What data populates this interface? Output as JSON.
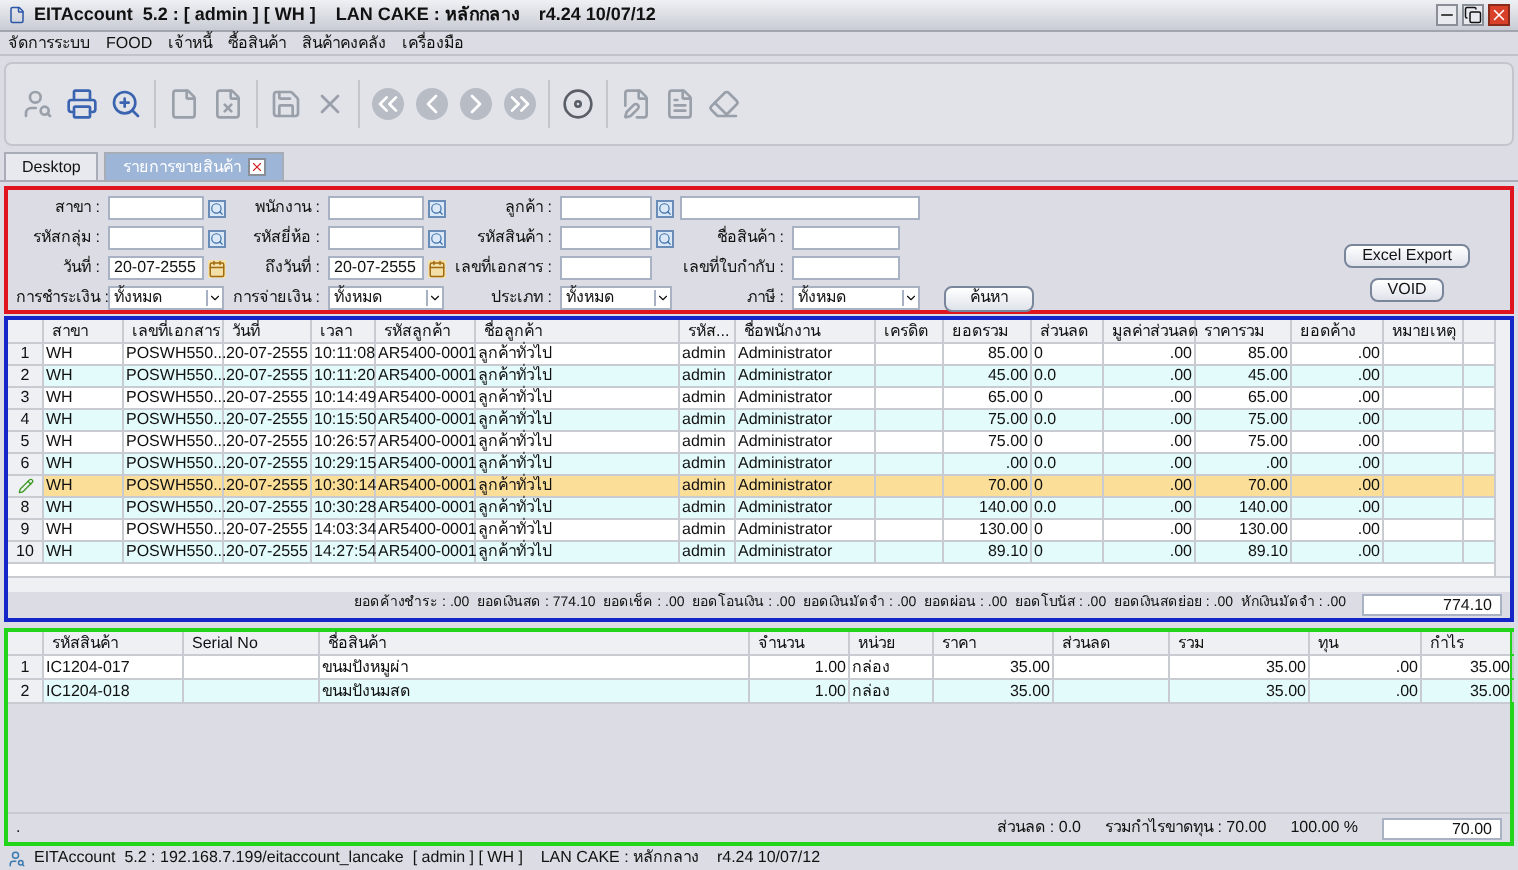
{
  "window": {
    "title": "EITAccount  5.2 : [ admin ] [ WH ]    LAN CAKE : หลักกลาง    r4.24 10/07/12"
  },
  "menu": [
    "จัดการระบบ",
    "FOOD",
    "เจ้าหนี้",
    "ซื้อสินค้า",
    "สินค้าคงคลัง",
    "เครื่องมือ"
  ],
  "tabs": [
    {
      "label": "Desktop",
      "selected": false,
      "closable": false
    },
    {
      "label": "รายการขายสินค้า",
      "selected": true,
      "closable": true
    }
  ],
  "filters": [
    [
      {
        "kind": "lookup",
        "label": "สาขา :"
      },
      {
        "kind": "lookup",
        "label": "พนักงาน :"
      },
      {
        "kind": "lookup",
        "label": "ลูกค้า :"
      },
      {
        "kind": "text"
      }
    ],
    [
      {
        "kind": "lookup",
        "label": "รหัสกลุ่ม :"
      },
      {
        "kind": "lookup",
        "label": "รหัสยี่ห้อ :"
      },
      {
        "kind": "lookup",
        "label": "รหัสสินค้า :"
      },
      {
        "kind": "text",
        "label": "ชื่อสินค้า :"
      }
    ],
    [
      {
        "kind": "date",
        "label": "วันที่ :",
        "value": "20-07-2555"
      },
      {
        "kind": "date",
        "label": "ถึงวันที่ :",
        "value": "20-07-2555"
      },
      {
        "kind": "text",
        "label": "เลขที่เอกสาร :"
      },
      {
        "kind": "text",
        "label": "เลขที่ใบกำกับ :"
      }
    ],
    [
      {
        "kind": "select",
        "label": "การชำระเงิน :",
        "value": "ทั้งหมด"
      },
      {
        "kind": "select",
        "label": "การจ่ายเงิน :",
        "value": "ทั้งหมด"
      },
      {
        "kind": "select",
        "label": "ประเภท :",
        "value": "ทั้งหมด"
      },
      {
        "kind": "select",
        "label": "ภาษี :",
        "value": "ทั้งหมด"
      },
      {
        "kind": "button",
        "label": "ค้นหา"
      }
    ]
  ],
  "actions": [
    "Excel Export",
    "VOID"
  ],
  "sales": {
    "columns": [
      "สาขา",
      "เลขที่เอกสาร",
      "วันที่",
      "เวลา",
      "รหัสลูกค้า",
      "ชื่อลูกค้า",
      "รหัส...",
      "ชื่อพนักงาน",
      "เครดิต",
      "ยอดรวม",
      "ส่วนลด",
      "มูลค่าส่วนลด",
      "ราคารวม",
      "ยอดค้าง",
      "หมายเหตุ"
    ],
    "rows": [
      {
        "number": "1",
        "selected": false,
        "cells": [
          "WH",
          "POSWH550...",
          "20-07-2555",
          "10:11:08",
          "AR5400-0001",
          "ลูกค้าทั่วไป",
          "admin",
          "Administrator",
          "",
          "85.00",
          "0",
          ".00",
          "85.00",
          ".00",
          ""
        ]
      },
      {
        "number": "2",
        "selected": false,
        "cells": [
          "WH",
          "POSWH550...",
          "20-07-2555",
          "10:11:20",
          "AR5400-0001",
          "ลูกค้าทั่วไป",
          "admin",
          "Administrator",
          "",
          "45.00",
          "0.0",
          ".00",
          "45.00",
          ".00",
          ""
        ]
      },
      {
        "number": "3",
        "selected": false,
        "cells": [
          "WH",
          "POSWH550...",
          "20-07-2555",
          "10:14:49",
          "AR5400-0001",
          "ลูกค้าทั่วไป",
          "admin",
          "Administrator",
          "",
          "65.00",
          "0",
          ".00",
          "65.00",
          ".00",
          ""
        ]
      },
      {
        "number": "4",
        "selected": false,
        "cells": [
          "WH",
          "POSWH550...",
          "20-07-2555",
          "10:15:50",
          "AR5400-0001",
          "ลูกค้าทั่วไป",
          "admin",
          "Administrator",
          "",
          "75.00",
          "0.0",
          ".00",
          "75.00",
          ".00",
          ""
        ]
      },
      {
        "number": "5",
        "selected": false,
        "cells": [
          "WH",
          "POSWH550...",
          "20-07-2555",
          "10:26:57",
          "AR5400-0001",
          "ลูกค้าทั่วไป",
          "admin",
          "Administrator",
          "",
          "75.00",
          "0",
          ".00",
          "75.00",
          ".00",
          ""
        ]
      },
      {
        "number": "6",
        "selected": false,
        "cells": [
          "WH",
          "POSWH550...",
          "20-07-2555",
          "10:29:15",
          "AR5400-0001",
          "ลูกค้าทั่วไป",
          "admin",
          "Administrator",
          "",
          ".00",
          "0.0",
          ".00",
          ".00",
          ".00",
          ""
        ]
      },
      {
        "selected": true,
        "cells": [
          "WH",
          "POSWH550...",
          "20-07-2555",
          "10:30:14",
          "AR5400-0001",
          "ลูกค้าทั่วไป",
          "admin",
          "Administrator",
          "",
          "70.00",
          "0",
          ".00",
          "70.00",
          ".00",
          ""
        ]
      },
      {
        "number": "8",
        "selected": false,
        "cells": [
          "WH",
          "POSWH550...",
          "20-07-2555",
          "10:30:28",
          "AR5400-0001",
          "ลูกค้าทั่วไป",
          "admin",
          "Administrator",
          "",
          "140.00",
          "0.0",
          ".00",
          "140.00",
          ".00",
          ""
        ]
      },
      {
        "number": "9",
        "selected": false,
        "cells": [
          "WH",
          "POSWH550...",
          "20-07-2555",
          "14:03:34",
          "AR5400-0001",
          "ลูกค้าทั่วไป",
          "admin",
          "Administrator",
          "",
          "130.00",
          "0",
          ".00",
          "130.00",
          ".00",
          ""
        ]
      },
      {
        "number": "10",
        "selected": false,
        "cells": [
          "WH",
          "POSWH550...",
          "20-07-2555",
          "14:27:54",
          "AR5400-0001",
          "ลูกค้าทั่วไป",
          "admin",
          "Administrator",
          "",
          "89.10",
          "0",
          ".00",
          "89.10",
          ".00",
          ""
        ]
      }
    ],
    "summary": "ยอดค้างชำระ : .00  ยอดเงินสด : 774.10  ยอดเช็ค : .00  ยอดโอนเงิน : .00  ยอดเงินมัดจำ : .00  ยอดผ่อน : .00  ยอดโบนัส : .00  ยอดเงินสดย่อย : .00  หักเงินมัดจำ : .00",
    "total": "774.10"
  },
  "items": {
    "columns": [
      "รหัสสินค้า",
      "Serial No",
      "ชื่อสินค้า",
      "จำนวน",
      "หน่วย",
      "ราคา",
      "ส่วนลด",
      "รวม",
      "ทุน",
      "กำไร"
    ],
    "rows": [
      {
        "number": "1",
        "cells": [
          "IC1204-017",
          "",
          "ขนมปังหมูผ่า",
          "1.00",
          "กล่อง",
          "35.00",
          "",
          "35.00",
          ".00",
          "35.00"
        ]
      },
      {
        "number": "2",
        "cells": [
          "IC1204-018",
          "",
          "ขนมปังนมสด",
          "1.00",
          "กล่อง",
          "35.00",
          "",
          "35.00",
          ".00",
          "35.00"
        ]
      }
    ],
    "footer_mark": ".",
    "discount": "ส่วนลด : 0.0",
    "profit": "รวมกำไรขาดทุน : 70.00",
    "percent": "100.00 %",
    "total": "70.00"
  },
  "status_bar": "EITAccount  5.2 : 192.168.7.199/eitaccount_lancake  [ admin ] [ WH ]    LAN CAKE : หลักกลาง    r4.24 10/07/12"
}
